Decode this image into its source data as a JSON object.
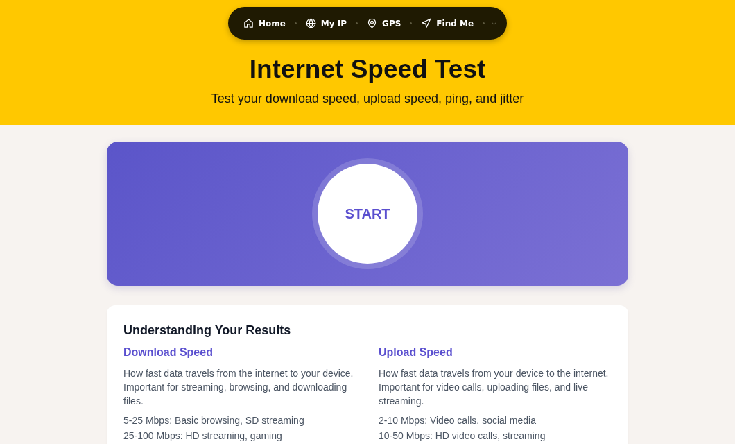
{
  "nav": {
    "items": [
      {
        "label": "Home"
      },
      {
        "label": "My IP"
      },
      {
        "label": "GPS"
      },
      {
        "label": "Find Me"
      }
    ]
  },
  "header": {
    "title": "Internet Speed Test",
    "subtitle": "Test your download speed, upload speed, ping, and jitter"
  },
  "speed_test": {
    "start_label": "START"
  },
  "results_guide": {
    "title": "Understanding Your Results",
    "columns": [
      {
        "heading": "Download Speed",
        "description": "How fast data travels from the internet to your device. Important for streaming, browsing, and downloading files.",
        "tiers": [
          "5-25 Mbps: Basic browsing, SD streaming",
          "25-100 Mbps: HD streaming, gaming"
        ]
      },
      {
        "heading": "Upload Speed",
        "description": "How fast data travels from your device to the internet. Important for video calls, uploading files, and live streaming.",
        "tiers": [
          "2-10 Mbps: Video calls, social media",
          "10-50 Mbps: HD video calls, streaming"
        ]
      }
    ]
  }
}
